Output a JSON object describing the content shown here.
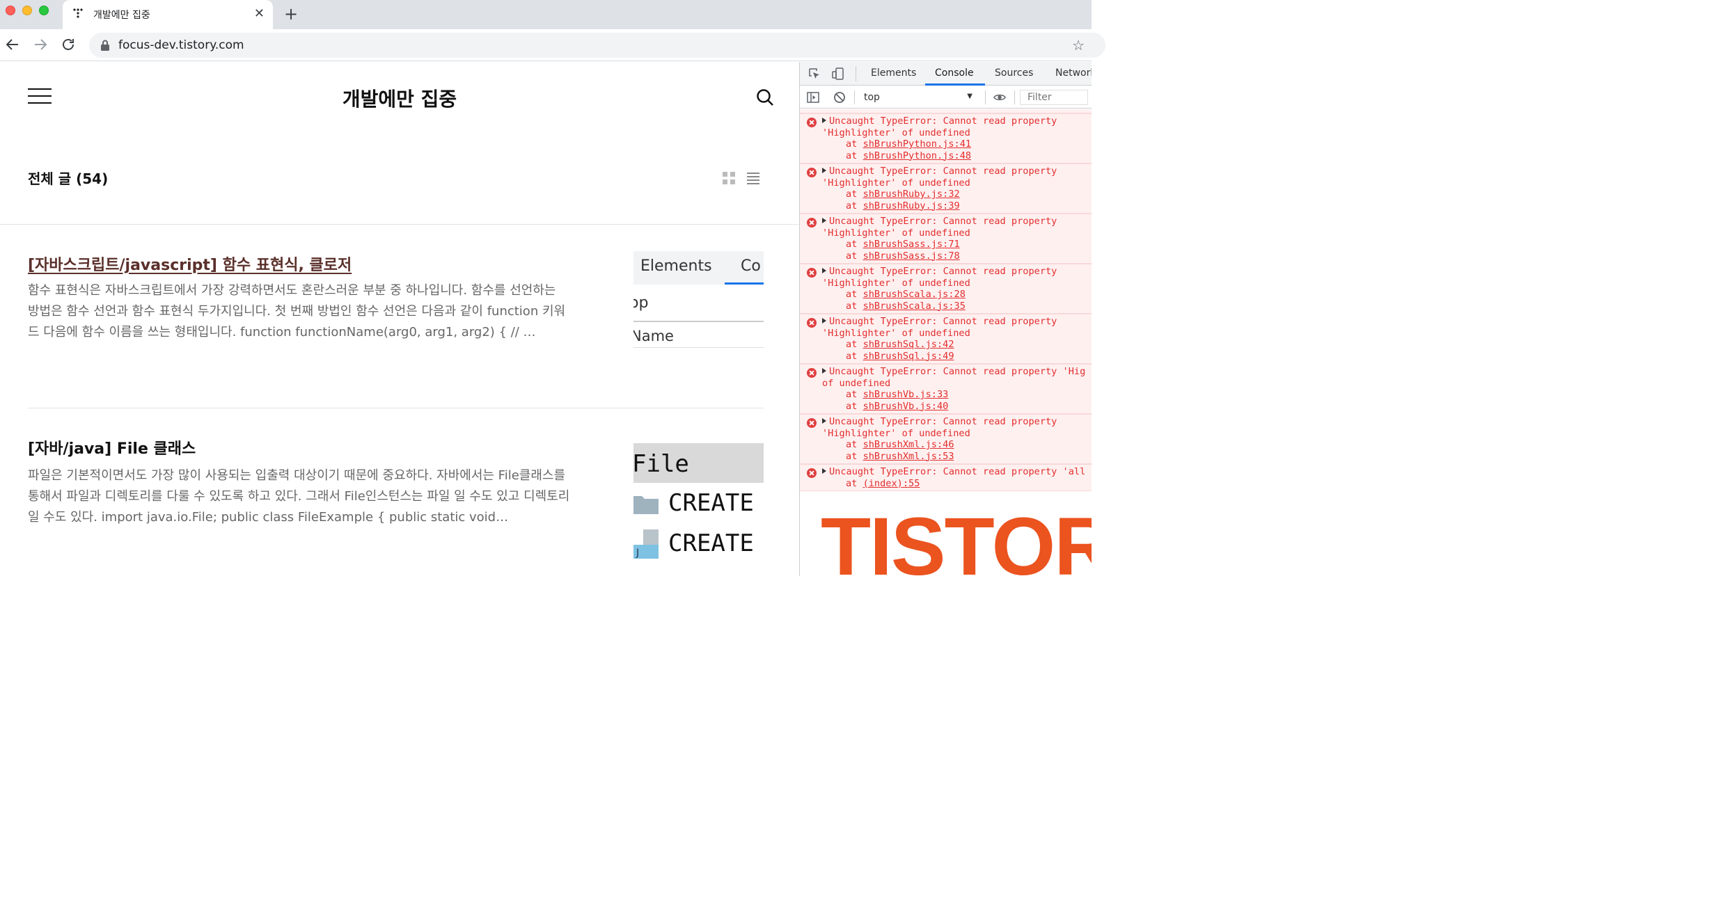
{
  "browser": {
    "tab_title": "개발에만 집중",
    "url": "focus-dev.tistory.com"
  },
  "page": {
    "blog_title": "개발에만 집중",
    "section_title": "전체 글 (54)",
    "posts": [
      {
        "title": "[자바스크립트/javascript] 함수 표현식, 클로저",
        "excerpt": "함수 표현식은 자바스크립트에서 가장 강력하면서도 혼란스러운 부분 중 하나입니다. 함수를 선언하는 방법은 함수 선언과 함수 표현식 두가지입니다. 첫 번째 방법인 함수 선언은 다음과 같이 function 키워드 다음에 함수 이름을 쓰는 형태입니다. function functionName(arg0, arg1, arg2) { // …",
        "thumb_texts": [
          "Elements",
          "Co",
          "op",
          "Name"
        ]
      },
      {
        "title": "[자바/java] File 클래스",
        "excerpt": "파일은 기본적이면서도 가장 많이 사용되는 입출력 대상이기 때문에 중요하다. 자바에서는 File클래스를 통해서 파일과 디렉토리를 다룰 수 있도록 하고 있다. 그래서 File인스턴스는 파일 일 수도 있고 디렉토리 일 수도 있다. import java.io.File; public class FileExample { public static void…",
        "thumb_texts": [
          "File",
          "CREATE",
          "CREATE"
        ]
      }
    ]
  },
  "devtools": {
    "tabs": [
      "Elements",
      "Console",
      "Sources",
      "Network"
    ],
    "active_tab": "Console",
    "context": "top",
    "filter_placeholder": "Filter",
    "messages": [
      {
        "line1": "Uncaught TypeError: Cannot read property",
        "line2": "'Highlighter' of undefined",
        "at": [
          "shBrushPython.js:41",
          "shBrushPython.js:48"
        ]
      },
      {
        "line1": "Uncaught TypeError: Cannot read property",
        "line2": "'Highlighter' of undefined",
        "at": [
          "shBrushRuby.js:32",
          "shBrushRuby.js:39"
        ]
      },
      {
        "line1": "Uncaught TypeError: Cannot read property",
        "line2": "'Highlighter' of undefined",
        "at": [
          "shBrushSass.js:71",
          "shBrushSass.js:78"
        ]
      },
      {
        "line1": "Uncaught TypeError: Cannot read property",
        "line2": "'Highlighter' of undefined",
        "at": [
          "shBrushScala.js:28",
          "shBrushScala.js:35"
        ]
      },
      {
        "line1": "Uncaught TypeError: Cannot read property",
        "line2": "'Highlighter' of undefined",
        "at": [
          "shBrushSql.js:42",
          "shBrushSql.js:49"
        ]
      },
      {
        "line1": "Uncaught TypeError: Cannot read property 'Hig",
        "line2": "of undefined",
        "at": [
          "shBrushVb.js:33",
          "shBrushVb.js:40"
        ]
      },
      {
        "line1": "Uncaught TypeError: Cannot read property",
        "line2": "'Highlighter' of undefined",
        "at": [
          "shBrushXml.js:46",
          "shBrushXml.js:53"
        ]
      },
      {
        "line1": "Uncaught TypeError: Cannot read property 'all",
        "line2": "",
        "at": [
          "(index):55"
        ]
      }
    ],
    "brand_banner": "TISTORY"
  },
  "colors": {
    "error_text": "#e22e2e",
    "error_bg": "#fff0f0",
    "accent_blue": "#1a73e8",
    "tistory_orange": "#eb531f",
    "post_link": "#5a2f2a"
  }
}
